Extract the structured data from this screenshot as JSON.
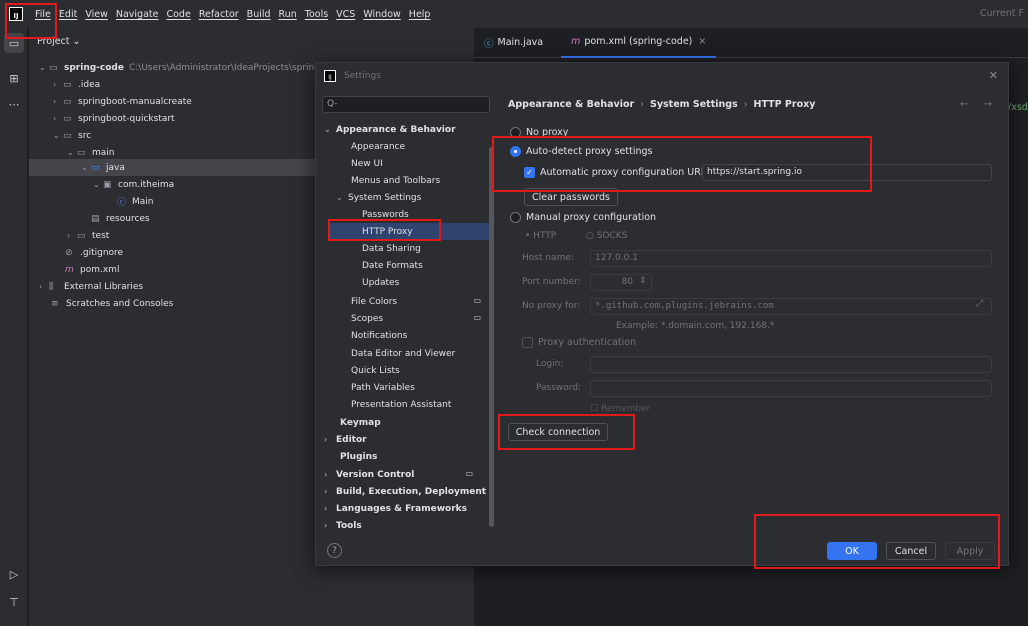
{
  "menubar": {
    "logo": "IJ",
    "items": [
      "File",
      "Edit",
      "View",
      "Navigate",
      "Code",
      "Refactor",
      "Build",
      "Run",
      "Tools",
      "VCS",
      "Window",
      "Help"
    ],
    "right_text": "Current F"
  },
  "project": {
    "header": "Project ⌄",
    "tree": [
      {
        "label": "spring-code",
        "path": "C:\\Users\\Administrator\\IdeaProjects\\spring"
      },
      {
        "label": ".idea"
      },
      {
        "label": "springboot-manualcreate"
      },
      {
        "label": "springboot-quickstart"
      },
      {
        "label": "src"
      },
      {
        "label": "main"
      },
      {
        "label": "java"
      },
      {
        "label": "com.itheima"
      },
      {
        "label": "Main"
      },
      {
        "label": "resources"
      },
      {
        "label": "test"
      },
      {
        "label": ".gitignore"
      },
      {
        "label": "pom.xml"
      },
      {
        "label": "External Libraries"
      },
      {
        "label": "Scratches and Consoles"
      }
    ]
  },
  "editor": {
    "tabs": [
      {
        "label": "Main.java"
      },
      {
        "label": "pom.xml (spring-code)"
      }
    ],
    "side_text": "/xsd"
  },
  "dialog": {
    "title": "Settings",
    "search_placeholder": "Q-",
    "nav": [
      {
        "label": "Appearance & Behavior"
      },
      {
        "label": "Appearance"
      },
      {
        "label": "New UI"
      },
      {
        "label": "Menus and Toolbars"
      },
      {
        "label": "System Settings"
      },
      {
        "label": "Passwords"
      },
      {
        "label": "HTTP Proxy"
      },
      {
        "label": "Data Sharing"
      },
      {
        "label": "Date Formats"
      },
      {
        "label": "Updates"
      },
      {
        "label": "File Colors"
      },
      {
        "label": "Scopes"
      },
      {
        "label": "Notifications"
      },
      {
        "label": "Data Editor and Viewer"
      },
      {
        "label": "Quick Lists"
      },
      {
        "label": "Path Variables"
      },
      {
        "label": "Presentation Assistant"
      },
      {
        "label": "Keymap"
      },
      {
        "label": "Editor"
      },
      {
        "label": "Plugins"
      },
      {
        "label": "Version Control"
      },
      {
        "label": "Build, Execution, Deployment"
      },
      {
        "label": "Languages & Frameworks"
      },
      {
        "label": "Tools"
      }
    ],
    "breadcrumb": [
      "Appearance & Behavior",
      "System Settings",
      "HTTP Proxy"
    ],
    "nav_arrows": "← →",
    "proxy": {
      "no_proxy": "No proxy",
      "auto_detect": "Auto-detect proxy settings",
      "auto_url_label": "Automatic proxy configuration URL:",
      "auto_url_value": "https://start.spring.io",
      "clear_passwords": "Clear passwords",
      "manual": "Manual proxy configuration",
      "http": "HTTP",
      "socks": "SOCKS",
      "host_label": "Host name:",
      "host_value": "127.0.0.1",
      "port_label": "Port number:",
      "port_value": "80",
      "no_proxy_label": "No proxy for:",
      "no_proxy_value": "*.github.com,plugins.jebrains.com",
      "example": "Example: *.domain.com, 192.168.*",
      "proxy_auth": "Proxy authentication",
      "login_label": "Login:",
      "password_label": "Password:",
      "remember": "Remember",
      "check_connection": "Check connection"
    },
    "buttons": {
      "ok": "OK",
      "cancel": "Cancel",
      "apply": "Apply"
    },
    "help": "?"
  },
  "colors": {
    "accent": "#3574f0",
    "highlight": "#e0191b"
  }
}
